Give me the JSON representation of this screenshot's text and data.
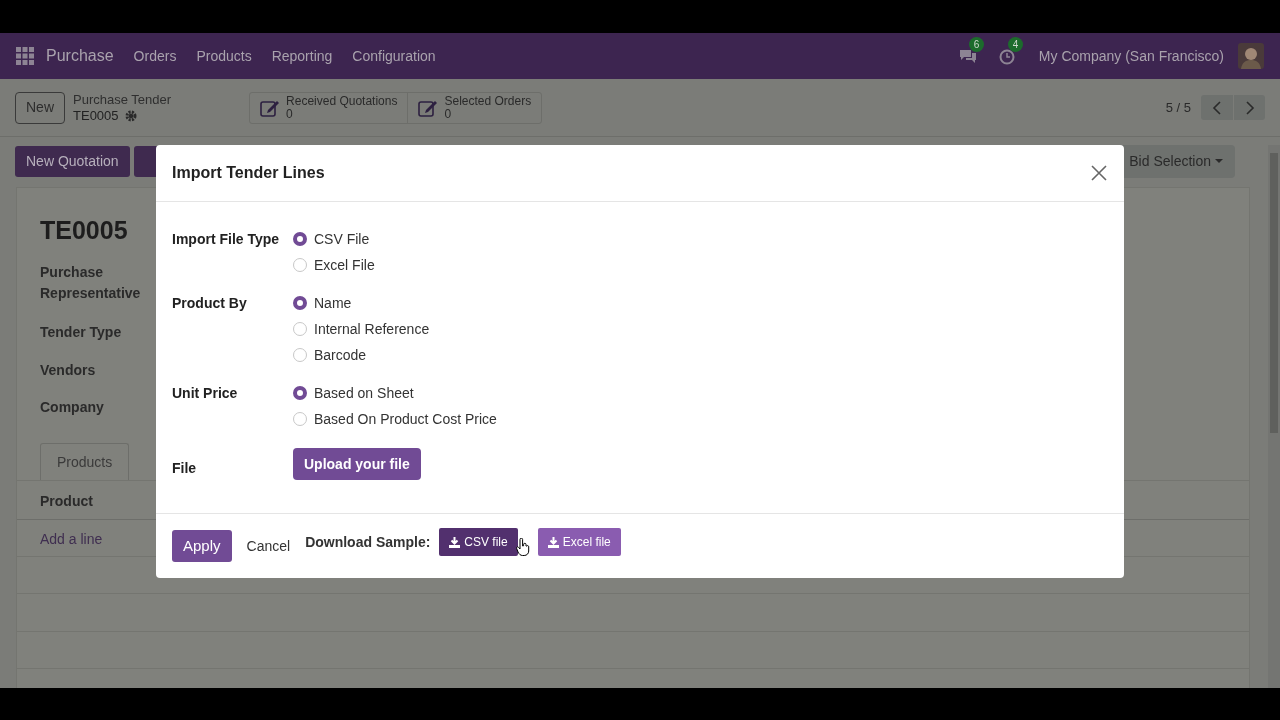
{
  "navbar": {
    "app_name": "Purchase",
    "menu": [
      "Orders",
      "Products",
      "Reporting",
      "Configuration"
    ],
    "messages_count": "6",
    "activities_count": "4",
    "company": "My Company (San Francisco)"
  },
  "control_panel": {
    "new_button": "New",
    "breadcrumb_parent": "Purchase Tender",
    "record_name": "TE0005",
    "smart_buttons": [
      {
        "label": "Received Quotations",
        "count": "0"
      },
      {
        "label": "Selected Orders",
        "count": "0"
      }
    ],
    "pager": "5 / 5"
  },
  "form": {
    "action_buttons": [
      "New Quotation"
    ],
    "bid_selection": "Bid Selection",
    "title": "TE0005",
    "field_labels": [
      "Purchase Representative",
      "Tender Type",
      "Vendors",
      "Company"
    ],
    "tabs": [
      {
        "label": "Products",
        "selected": true
      }
    ],
    "column": "Product",
    "add_line": "Add a line"
  },
  "dialog": {
    "title": "Import Tender Lines",
    "groups": [
      {
        "label": "Import File Type",
        "options": [
          {
            "label": "CSV File",
            "selected": true
          },
          {
            "label": "Excel File",
            "selected": false
          }
        ]
      },
      {
        "label": "Product By",
        "options": [
          {
            "label": "Name",
            "selected": true
          },
          {
            "label": "Internal Reference",
            "selected": false
          },
          {
            "label": "Barcode",
            "selected": false
          }
        ]
      },
      {
        "label": "Unit Price",
        "options": [
          {
            "label": "Based on Sheet",
            "selected": true
          },
          {
            "label": "Based On Product Cost Price",
            "selected": false
          }
        ]
      }
    ],
    "file_label": "File",
    "upload_button": "Upload your file",
    "apply": "Apply",
    "cancel": "Cancel",
    "download_label": "Download Sample:",
    "download_buttons": [
      {
        "label": "CSV file",
        "hovered": true
      },
      {
        "label": "Excel file",
        "hovered": false
      }
    ]
  }
}
